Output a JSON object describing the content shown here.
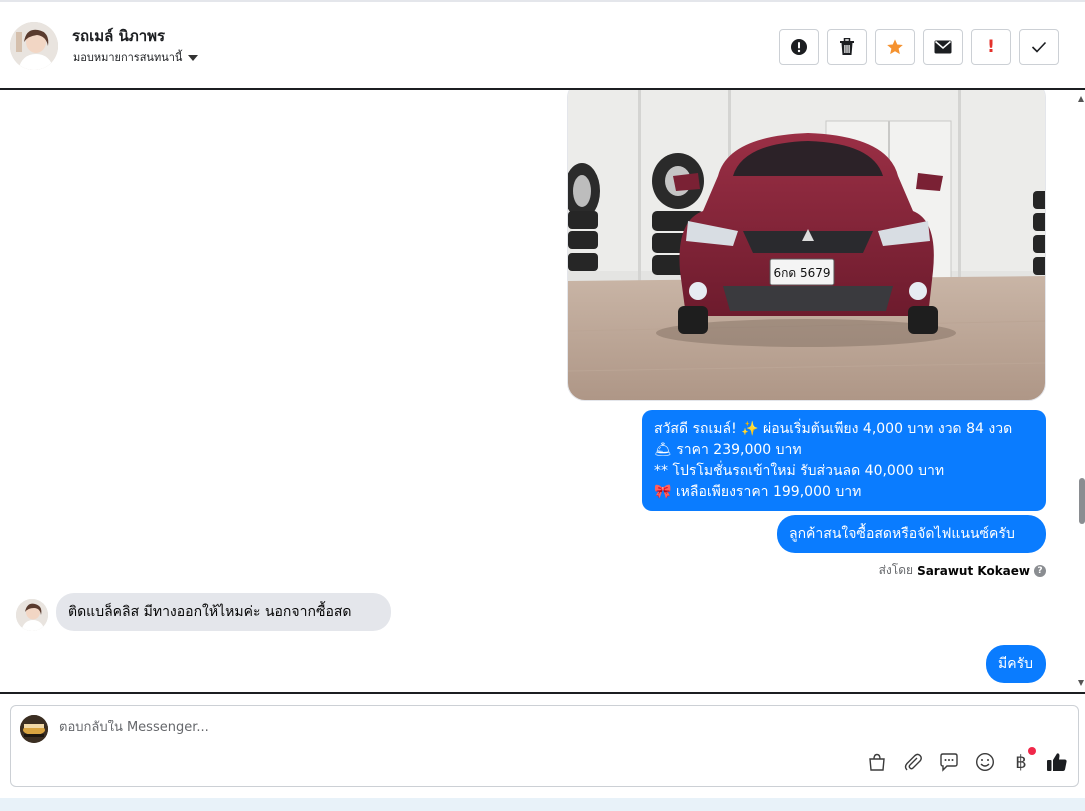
{
  "contact": {
    "name": "รถเมล์ นิภาพร",
    "assignment_label": "มอบหมายการสนทนานี้"
  },
  "toolbar": {
    "icons": [
      "alert-circle-icon",
      "trash-icon",
      "star-icon",
      "envelope-icon",
      "exclamation-icon",
      "check-icon"
    ],
    "star_color": "#f5922f",
    "spam_label": "!"
  },
  "messages": [
    {
      "type": "image",
      "direction": "outgoing",
      "content": "car-photo",
      "plate": "6กด 5679"
    },
    {
      "type": "text",
      "direction": "outgoing",
      "lines": [
        "สวัสดี รถเมล์! ✨  ผ่อนเริ่มต้นเพียง 4,000 บาท งวด 84 งวด",
        "🛎 ราคา 239,000 บาท",
        "** โปรโมชั่นรถเข้าใหม่ รับส่วนลด 40,000 บาท",
        "🎀  เหลือเพียงราคา 199,000 บาท"
      ]
    },
    {
      "type": "text",
      "direction": "outgoing",
      "text": "ลูกค้าสนใจซื้อสดหรือจัดไฟแนนซ์ครับ"
    },
    {
      "type": "text",
      "direction": "incoming",
      "text": "ติดแบล็คลิส มีทางออกให้ไหมค่ะ นอกจากซื้อสด"
    },
    {
      "type": "text",
      "direction": "outgoing",
      "text": "มีครับ"
    }
  ],
  "sent_by": {
    "prefix": "ส่งโดย",
    "name": "Sarawut Kokaew",
    "help": "?"
  },
  "composer": {
    "placeholder": "ตอบกลับใน Messenger...",
    "tools": [
      "bag-icon",
      "paperclip-icon",
      "chat-bubble-icon",
      "smiley-icon",
      "baht-icon",
      "thumbs-up-icon"
    ],
    "baht_symbol": "฿"
  },
  "colors": {
    "outgoing_bubble": "#0a7cff",
    "incoming_bubble": "#e4e6eb",
    "notification_dot": "#f0284a"
  }
}
